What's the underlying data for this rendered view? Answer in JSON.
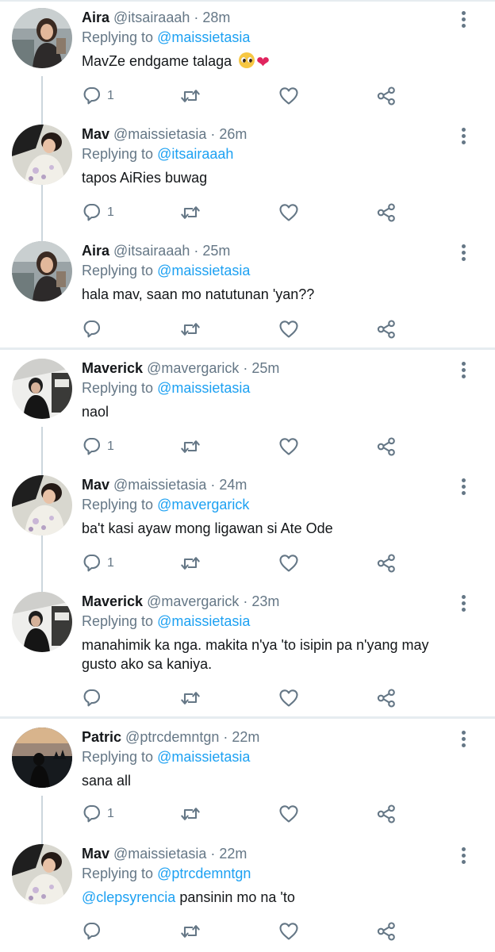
{
  "thread": {
    "tweets": [
      {
        "name": "Aira",
        "handle": "@itsairaaah",
        "separator": "·",
        "time": "28m",
        "replying_prefix": "Replying to",
        "replying_to": "@maissietasia",
        "text": "MavZe endgame talaga",
        "emojis": [
          "pleading-face",
          "red-heart"
        ],
        "reply_count": "1",
        "avatar": "aira-avatar"
      },
      {
        "name": "Mav",
        "handle": "@maissietasia",
        "separator": "·",
        "time": "26m",
        "replying_prefix": "Replying to",
        "replying_to": "@itsairaaah",
        "text": "tapos AiRies buwag",
        "reply_count": "1",
        "avatar": "mav-avatar"
      },
      {
        "name": "Aira",
        "handle": "@itsairaaah",
        "separator": "·",
        "time": "25m",
        "replying_prefix": "Replying to",
        "replying_to": "@maissietasia",
        "text": "hala mav, saan mo natutunan 'yan??",
        "reply_count": "",
        "avatar": "aira-avatar"
      },
      {
        "name": "Maverick",
        "handle": "@mavergarick",
        "separator": "·",
        "time": "25m",
        "replying_prefix": "Replying to",
        "replying_to": "@maissietasia",
        "text": "naol",
        "reply_count": "1",
        "avatar": "maverick-avatar"
      },
      {
        "name": "Mav",
        "handle": "@maissietasia",
        "separator": "·",
        "time": "24m",
        "replying_prefix": "Replying to",
        "replying_to": "@mavergarick",
        "text": "ba't kasi ayaw mong ligawan si Ate Ode",
        "reply_count": "1",
        "avatar": "mav-avatar"
      },
      {
        "name": "Maverick",
        "handle": "@mavergarick",
        "separator": "·",
        "time": "23m",
        "replying_prefix": "Replying to",
        "replying_to": "@maissietasia",
        "text_line1": "manahimik ka nga. makita n'ya 'to isipin pa n'yang may",
        "text_line2": "gusto ako sa kaniya.",
        "reply_count": "",
        "avatar": "maverick-avatar"
      },
      {
        "name": "Patric",
        "handle": "@ptrcdemntgn",
        "separator": "·",
        "time": "22m",
        "replying_prefix": "Replying to",
        "replying_to": "@maissietasia",
        "text": "sana all",
        "reply_count": "1",
        "avatar": "patric-avatar"
      },
      {
        "name": "Mav",
        "handle": "@maissietasia",
        "separator": "·",
        "time": "22m",
        "replying_prefix": "Replying to",
        "replying_to": "@ptrcdemntgn",
        "mention": "@clepsyrencia",
        "text": "pansinin mo na 'to",
        "reply_count": "",
        "avatar": "mav-avatar"
      }
    ]
  },
  "icons": {
    "reply": "reply-bubble-icon",
    "retweet": "retweet-icon",
    "like": "heart-icon",
    "share": "share-icon",
    "more": "more-options-icon"
  },
  "colors": {
    "link": "#1da1f2",
    "secondary_text": "#657786",
    "primary_text": "#14171a",
    "divider": "#e6ecf0",
    "thread_line": "#ccd6dd",
    "heart_emoji": "#e0245e"
  }
}
